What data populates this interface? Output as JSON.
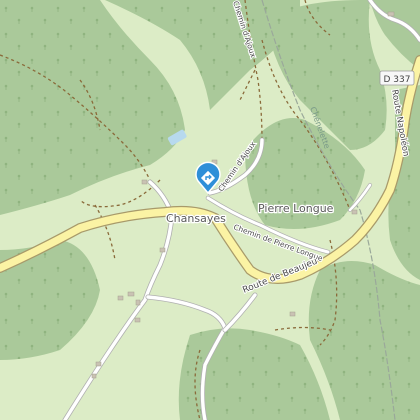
{
  "map": {
    "places": {
      "chansayes": "Chansayes",
      "pierre_longue": "Pierre Longue"
    },
    "roads": {
      "chemin_ajoux_north": "Chemin d'Ajoux",
      "chemin_ajoux": "Chemin d'Ajoux",
      "chemin_pierre_longue": "Chemin de Pierre Longue",
      "route_beaujeu": "Route de Beaujeu",
      "route_napoleon": "Route Napoléon",
      "chenelette": "Chénelette"
    },
    "road_shield": "D 337",
    "colors": {
      "forest": "#aac99a",
      "meadow": "#dcecc6",
      "main_road_fill": "#fbf3a4",
      "main_road_casing": "#a89a6a",
      "track": "#8a6a3a",
      "poi_marker": "#2f8fd8",
      "water": "#b7d9ee"
    },
    "poi_icon": "diamond-direction-icon"
  }
}
